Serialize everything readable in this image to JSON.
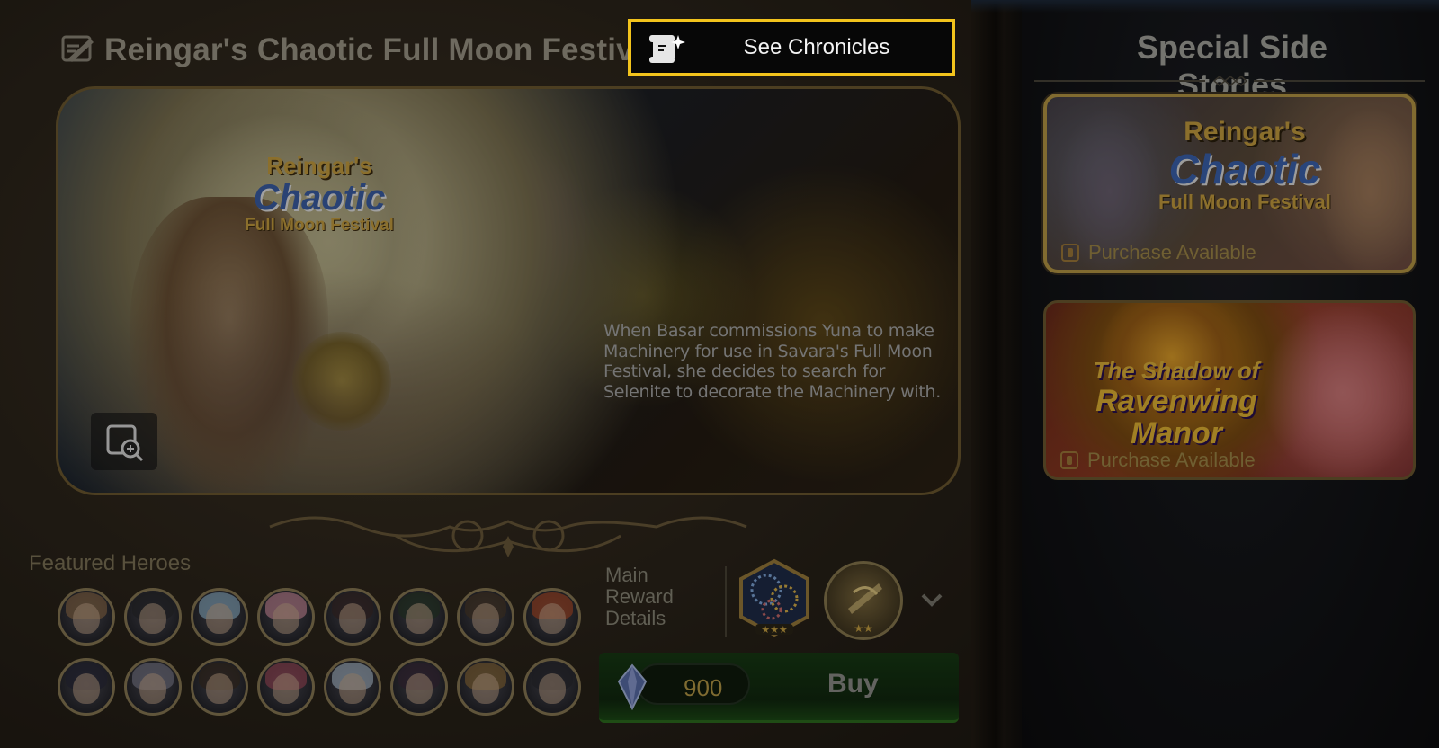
{
  "header": {
    "title": "Reingar's Chaotic Full Moon Festival",
    "title_icon": "chronicle-quill-icon"
  },
  "chronicles_button": {
    "label": "See Chronicles",
    "icon": "chronicle-scroll-icon"
  },
  "banner": {
    "logo_line1": "Reingar's",
    "logo_line2": "Chaotic",
    "logo_line3": "Full Moon Festival",
    "description": "When Basar commissions Yuna to make Machinery for use in Savara's Full Moon Festival, she decides to search for Selenite to decorate the Machinery with.",
    "zoom_icon": "magnify-icon"
  },
  "featured": {
    "label": "Featured Heroes",
    "heroes": [
      {
        "name": "hero-1",
        "hair": "#8a6a4a"
      },
      {
        "name": "hero-2",
        "hair": "#2a2a2e"
      },
      {
        "name": "hero-3",
        "hair": "#8fb2c8"
      },
      {
        "name": "hero-4",
        "hair": "#c88a9a"
      },
      {
        "name": "hero-5",
        "hair": "#3a2a28"
      },
      {
        "name": "hero-6",
        "hair": "#2a3a2a"
      },
      {
        "name": "hero-7",
        "hair": "#4a3a2a"
      },
      {
        "name": "hero-8",
        "hair": "#a84a28"
      },
      {
        "name": "hero-9",
        "hair": "#2a2a3a"
      },
      {
        "name": "hero-10",
        "hair": "#7a7a8a"
      },
      {
        "name": "hero-11",
        "hair": "#3a2e24"
      },
      {
        "name": "hero-12",
        "hair": "#9a4a5a"
      },
      {
        "name": "hero-13",
        "hair": "#a8b8c8"
      },
      {
        "name": "hero-14",
        "hair": "#3a2a3a"
      },
      {
        "name": "hero-15",
        "hair": "#8a6a3a"
      },
      {
        "name": "hero-16",
        "hair": "#2a2a30"
      }
    ]
  },
  "reward": {
    "label_line1": "Main",
    "label_line2": "Reward",
    "label_line3": "Details",
    "item1_icon": "fireworks-icon",
    "item2_icon": "ticket-icon",
    "expand_icon": "chevron-down-icon"
  },
  "purchase": {
    "price": "900",
    "currency_icon": "crystal-gem-icon",
    "buy_label": "Buy"
  },
  "side": {
    "title": "Special Side Stories",
    "stories": [
      {
        "logo_line1": "Reingar's",
        "logo_line2": "Chaotic",
        "logo_line3": "Full Moon Festival",
        "status": "Purchase Available"
      },
      {
        "logo_line1": "The Shadow of",
        "logo_line2": "Ravenwing",
        "logo_line3": "Manor",
        "status": "Purchase Available"
      }
    ]
  },
  "colors": {
    "highlight": "#f2c31c",
    "buy_green": "#1c4a16",
    "gold": "#c8a040"
  }
}
